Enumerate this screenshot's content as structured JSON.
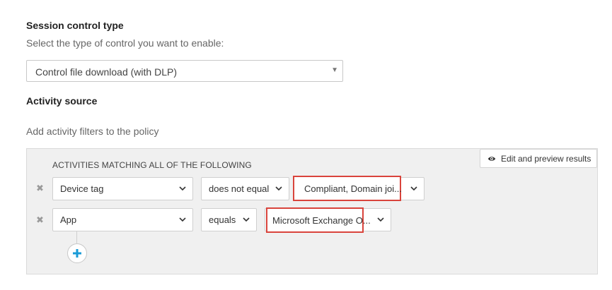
{
  "session_control": {
    "heading": "Session control type",
    "description": "Select the type of control you want to enable:",
    "selected": "Control file download (with DLP)"
  },
  "activity_source": {
    "heading": "Activity source",
    "description": "Add activity filters to the policy"
  },
  "filters_panel": {
    "title": "ACTIVITIES MATCHING ALL OF THE FOLLOWING",
    "edit_preview_label": "Edit and preview results",
    "rows": [
      {
        "field": "Device tag",
        "operator": "does not equal",
        "value": "Compliant, Domain joi..."
      },
      {
        "field": "App",
        "operator": "equals",
        "value": "Microsoft Exchange O..."
      }
    ]
  },
  "colors": {
    "highlight": "#d9443c",
    "add_icon": "#1a9bd7",
    "panel_bg": "#f0f0f0"
  },
  "icons": {
    "remove": "close-icon",
    "dropdown": "chevron-down-icon",
    "preview": "eye-icon",
    "add": "plus-icon"
  }
}
